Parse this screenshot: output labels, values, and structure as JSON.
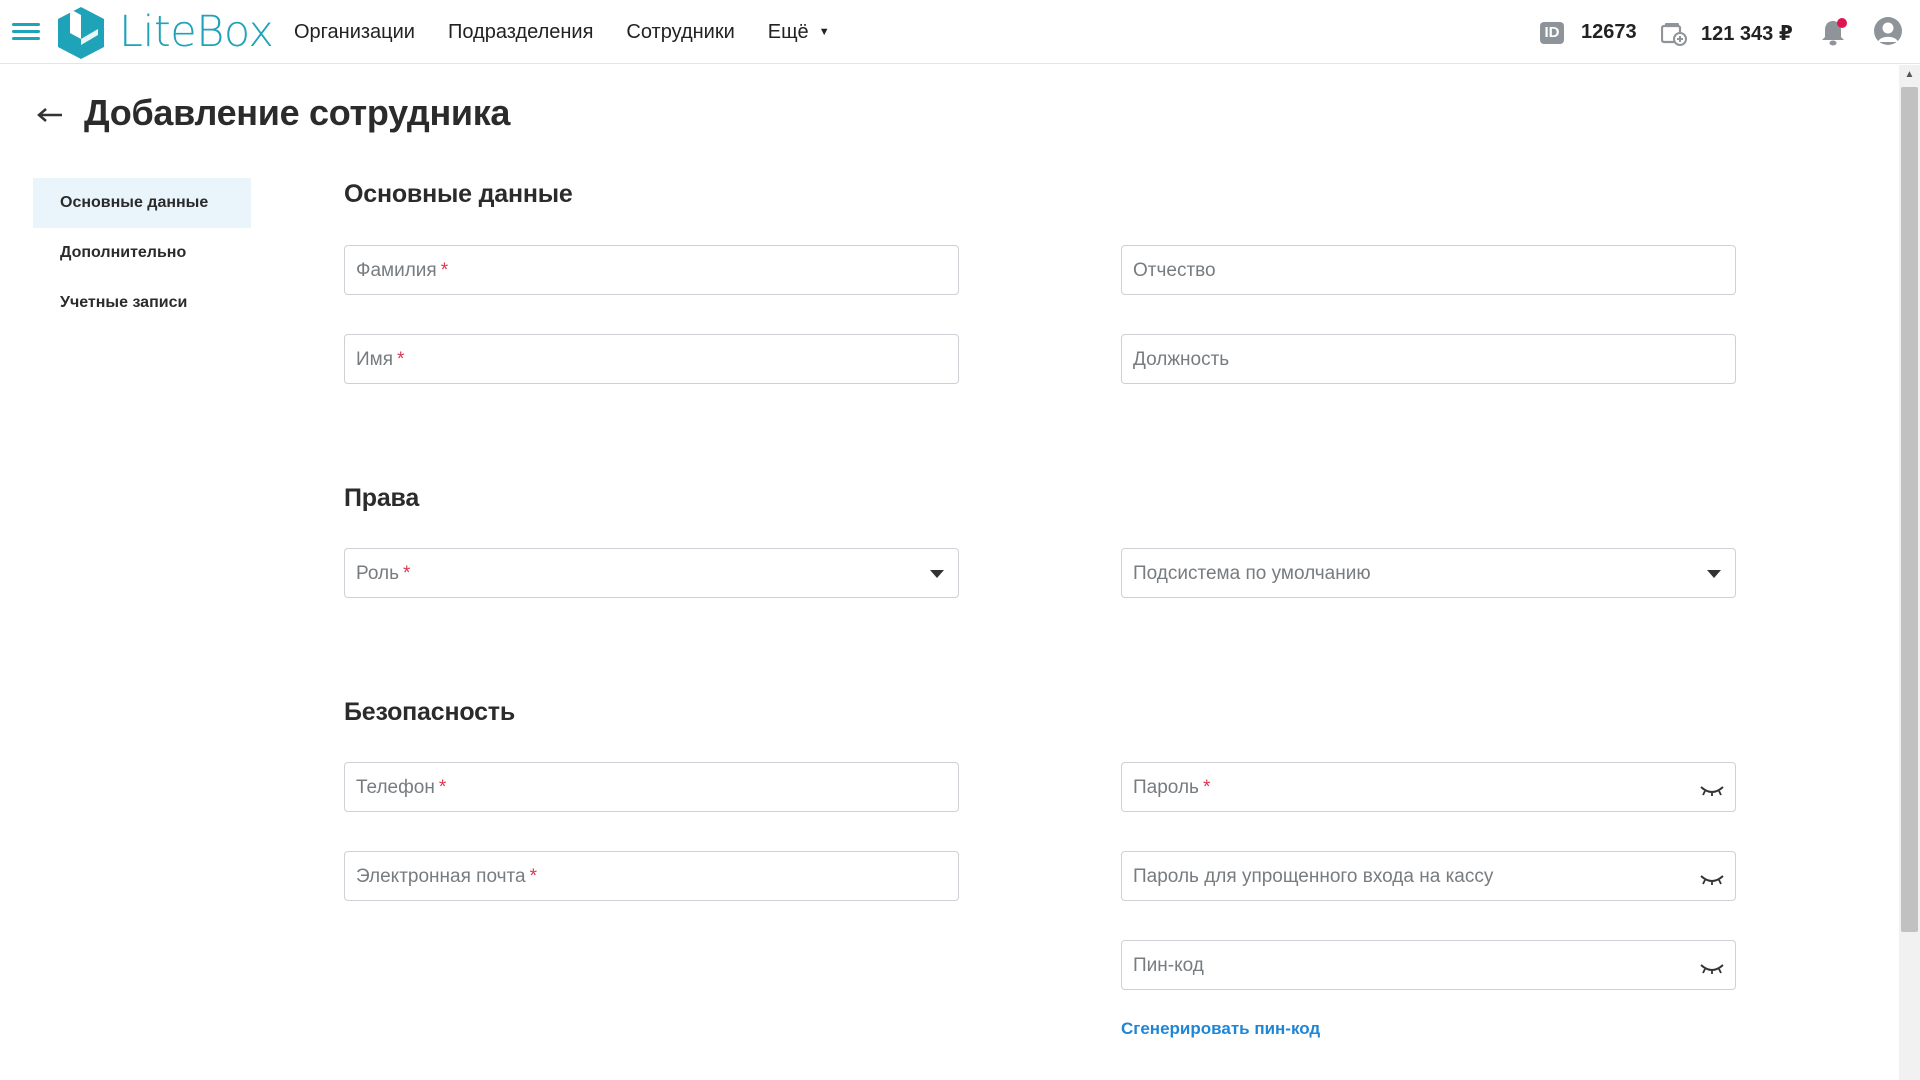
{
  "app": {
    "logo_text": "LiteBox",
    "accent": "#1ea3b8"
  },
  "nav": {
    "items": [
      {
        "label": "Организации"
      },
      {
        "label": "Подразделения"
      },
      {
        "label": "Сотрудники"
      },
      {
        "label": "Ещё"
      }
    ]
  },
  "account": {
    "id_badge": "ID",
    "id_value": "12673",
    "balance": "121 343 ₽"
  },
  "page": {
    "title": "Добавление сотрудника"
  },
  "side_menu": {
    "items": [
      {
        "label": "Основные данные",
        "active": true
      },
      {
        "label": "Дополнительно",
        "active": false
      },
      {
        "label": "Учетные записи",
        "active": false
      }
    ]
  },
  "sections": {
    "basic": {
      "title": "Основные данные",
      "last_name": "Фамилия",
      "first_name": "Имя",
      "middle_name": "Отчество",
      "position": "Должность"
    },
    "rights": {
      "title": "Права",
      "role": "Роль",
      "default_subsystem": "Подсистема по умолчанию"
    },
    "security": {
      "title": "Безопасность",
      "phone": "Телефон",
      "email": "Электронная почта",
      "password": "Пароль",
      "simple_password": "Пароль для упрощенного входа на кассу",
      "pin": "Пин-код",
      "generate_pin": "Сгенерировать пин-код"
    }
  },
  "required_mark": "*",
  "colors": {
    "required": "#e0364d",
    "link": "#1f86d6",
    "active_menu_bg": "#e9f4fb",
    "notification_dot": "#e0154f"
  }
}
